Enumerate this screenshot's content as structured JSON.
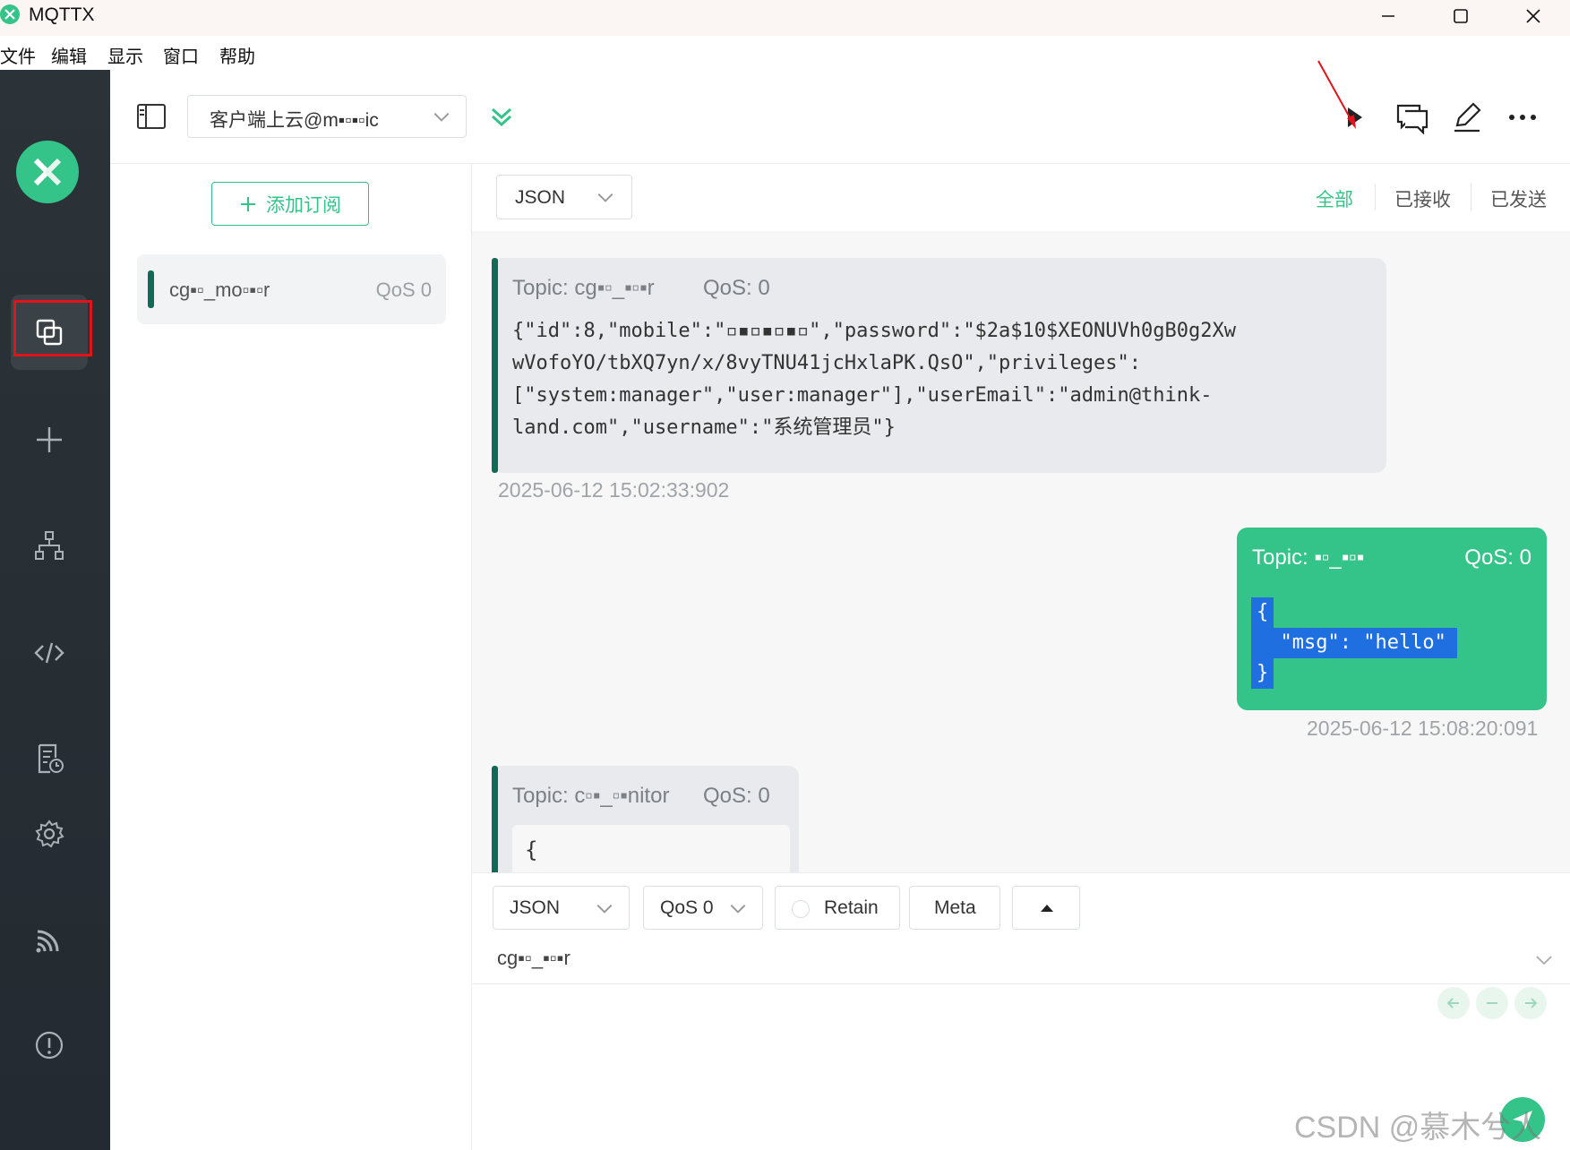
{
  "window": {
    "title": "MQTTX",
    "controls": [
      "minimize",
      "maximize",
      "close"
    ]
  },
  "menu": [
    "文件",
    "编辑",
    "显示",
    "窗口",
    "帮助"
  ],
  "sidebar": {
    "items": [
      {
        "name": "connections",
        "icon": "connections-icon",
        "active": true
      },
      {
        "name": "new-connection",
        "icon": "plus-icon"
      },
      {
        "name": "topology",
        "icon": "topology-icon"
      },
      {
        "name": "script",
        "icon": "code-icon"
      },
      {
        "name": "log",
        "icon": "log-icon"
      },
      {
        "name": "settings",
        "icon": "gear-icon"
      },
      {
        "name": "subscriptions-feed",
        "icon": "feed-icon"
      },
      {
        "name": "about",
        "icon": "info-icon"
      }
    ]
  },
  "header": {
    "connection_name": "客户端上云@m▪︎▫︎▪︎▫︎ic",
    "actions": [
      "play-icon",
      "messages-icon",
      "edit-icon",
      "more-icon"
    ]
  },
  "subscriptions": {
    "add_label": "添加订阅",
    "items": [
      {
        "topic": "cg▪︎▫︎_mo▫︎▪︎▫︎r",
        "qos": "QoS 0",
        "color": "#0f6b56"
      }
    ]
  },
  "messages": {
    "format": "JSON",
    "filters": [
      "全部",
      "已接收",
      "已发送"
    ],
    "active_filter": "全部",
    "list": [
      {
        "direction": "received",
        "topic": "Topic: cg▪︎▫︎_▪︎▫︎▪︎r",
        "qos": "QoS: 0",
        "payload_lines": [
          "{\"id\":8,\"mobile\":\"▫︎▪︎▫︎▪︎▫︎▪︎▫︎\",\"password\":\"$2a$10$XEONUVh0gB0g2Xw",
          "wVofoYO/tbXQ7yn/x/8vyTNU41jcHxlaPK.QsO\",\"privileges\":",
          "[\"system:manager\",\"user:manager\"],\"userEmail\":\"admin@think-",
          "land.com\",\"username\":\"系统管理员\"}"
        ],
        "time": "2025-06-12 15:02:33:902"
      },
      {
        "direction": "sent",
        "topic": "Topic: ▪︎▫︎_▪︎▫︎▪︎",
        "qos": "QoS: 0",
        "payload_lines": [
          "{",
          "  \"msg\": \"hello\"",
          "}"
        ],
        "time": "2025-06-12 15:08:20:091"
      },
      {
        "direction": "received",
        "topic": "Topic: c▫︎▪︎_▫︎▪︎nitor",
        "qos": "QoS: 0",
        "payload_lines": [
          "{"
        ]
      }
    ]
  },
  "compose": {
    "format": "JSON",
    "qos": "QoS 0",
    "retain_label": "Retain",
    "meta_label": "Meta",
    "topic": "cg▪︎▫︎_▪︎▫︎▪︎r"
  },
  "watermark": "CSDN @慕木兮人可",
  "colors": {
    "accent": "#34c388",
    "sidebar": "#262d33",
    "recv_bar": "#0f6b56",
    "annotation": "#e3131b"
  }
}
